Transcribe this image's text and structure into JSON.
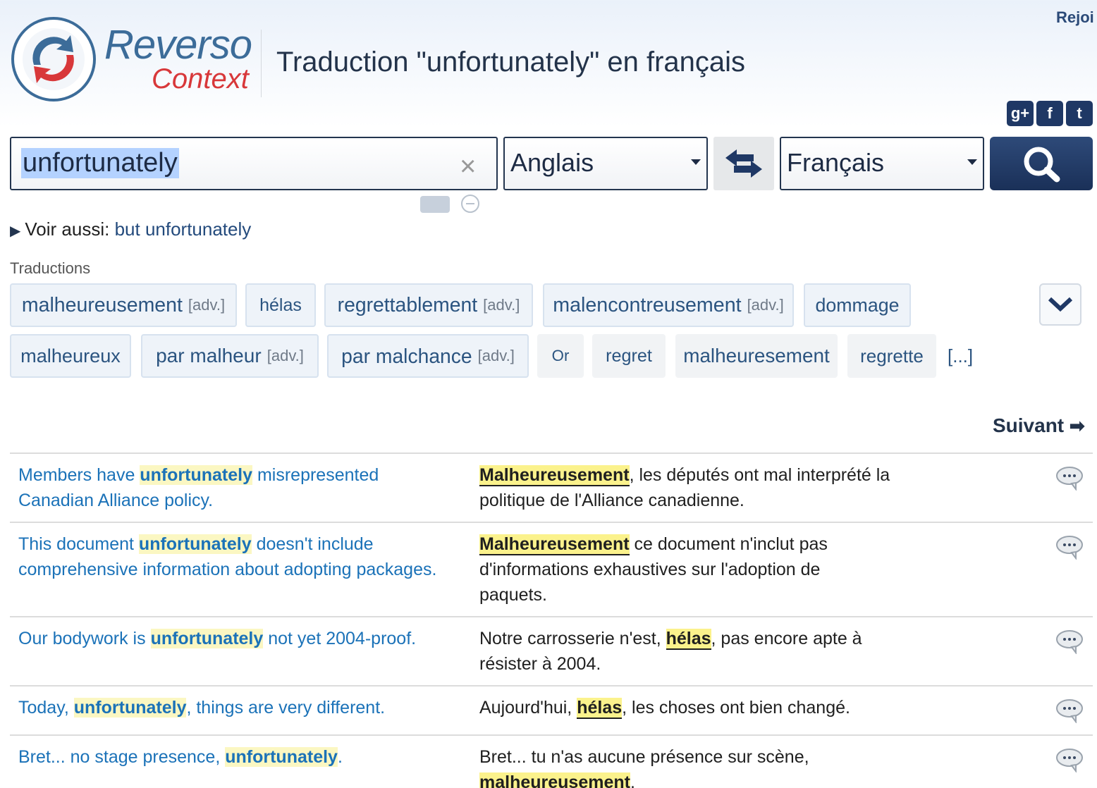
{
  "header": {
    "brand_line1": "Reverso",
    "brand_line2": "Context",
    "title": "Traduction \"unfortunately\" en français",
    "join_label": "Rejoi"
  },
  "social": {
    "google_label": "g+",
    "facebook_label": "f",
    "twitter_label": "t"
  },
  "search": {
    "value": "unfortunately",
    "clear_label": "×",
    "source_language": "Anglais",
    "target_language": "Français"
  },
  "see_also": {
    "label": "Voir aussi:",
    "link": "but unfortunately"
  },
  "translations": {
    "label": "Traductions",
    "items": [
      {
        "text": "malheureusement",
        "tag": "[adv.]"
      },
      {
        "text": "hélas",
        "tag": ""
      },
      {
        "text": "regrettablement",
        "tag": "[adv.]"
      },
      {
        "text": "malencontreusement",
        "tag": "[adv.]"
      },
      {
        "text": "dommage",
        "tag": ""
      },
      {
        "text": "malheureux",
        "tag": ""
      },
      {
        "text": "par malheur",
        "tag": "[adv.]"
      },
      {
        "text": "par malchance",
        "tag": "[adv.]"
      },
      {
        "text": "Or",
        "tag": ""
      },
      {
        "text": "regret",
        "tag": ""
      },
      {
        "text": "malheuresement",
        "tag": ""
      },
      {
        "text": "regrette",
        "tag": ""
      }
    ],
    "more_label": "[...]"
  },
  "pagination": {
    "next_label": "Suivant"
  },
  "examples": [
    {
      "src_before": "Members have ",
      "src_hl": "unfortunately",
      "src_after": " misrepresented Canadian Alliance policy.",
      "tgt_before": "",
      "tgt_hl": "Malheureusement",
      "tgt_after": ", les députés ont mal interprété la politique de l'Alliance canadienne."
    },
    {
      "src_before": "This document ",
      "src_hl": "unfortunately",
      "src_after": " doesn't include comprehensive information about adopting packages.",
      "tgt_before": "",
      "tgt_hl": "Malheureusement",
      "tgt_after": " ce document n'inclut pas d'informations exhaustives sur l'adoption de paquets."
    },
    {
      "src_before": "Our bodywork is ",
      "src_hl": "unfortunately",
      "src_after": " not yet 2004-proof.",
      "tgt_before": "Notre carrosserie n'est, ",
      "tgt_hl": "hélas",
      "tgt_after": ", pas encore apte à résister à 2004."
    },
    {
      "src_before": "Today, ",
      "src_hl": "unfortunately",
      "src_after": ", things are very different.",
      "tgt_before": "Aujourd'hui, ",
      "tgt_hl": "hélas",
      "tgt_after": ", les choses ont bien changé."
    },
    {
      "src_before": "Bret... no stage presence, ",
      "src_hl": "unfortunately",
      "src_after": ".",
      "tgt_before": "Bret... tu n'as aucune présence sur scène, ",
      "tgt_hl": "malheureusement",
      "tgt_after": "."
    }
  ]
}
